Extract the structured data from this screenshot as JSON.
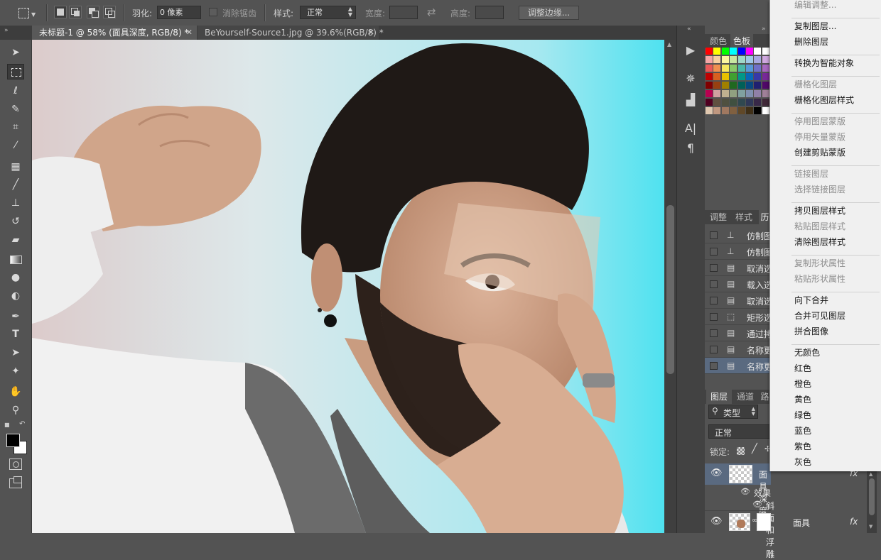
{
  "options_bar": {
    "feather_label": "羽化:",
    "feather_value": "0 像素",
    "antialias_label": "消除锯齿",
    "style_label": "样式:",
    "style_value": "正常",
    "width_label": "宽度:",
    "height_label": "高度:",
    "refine_edge_button": "调整边缘..."
  },
  "document_tabs": [
    {
      "label": "未标题-1 @ 58% (面具深度, RGB/8) *",
      "active": true
    },
    {
      "label": "BeYourself-Source1.jpg @ 39.6%(RGB/8) *",
      "active": false
    }
  ],
  "swatches_panel": {
    "tabs": [
      "颜色",
      "色板"
    ],
    "colors": [
      "#ff0000",
      "#ffff00",
      "#00ff00",
      "#00ffff",
      "#0000ff",
      "#ff00ff",
      "#ffffff",
      "#ffffff",
      "#f4a6a6",
      "#f8d0a0",
      "#fdf6a0",
      "#c8e6a0",
      "#a0d8c8",
      "#a0c8e8",
      "#a8a8e0",
      "#d0a8e0",
      "#e85858",
      "#f09050",
      "#f8e860",
      "#88c868",
      "#48b8a8",
      "#5898d8",
      "#7070c8",
      "#a868c0",
      "#c00000",
      "#d86020",
      "#e8c000",
      "#40a030",
      "#009888",
      "#0868b8",
      "#3838a8",
      "#782898",
      "#800000",
      "#984010",
      "#a08000",
      "#206820",
      "#006058",
      "#084880",
      "#202070",
      "#500868",
      "#b80050",
      "#d0a0a0",
      "#c0b090",
      "#90a080",
      "#80a0a0",
      "#8090b0",
      "#9080a8",
      "#a08098",
      "#500020",
      "#605040",
      "#505040",
      "#405040",
      "#304850",
      "#303858",
      "#382848",
      "#402838",
      "#e0c8b0",
      "#c09880",
      "#a07860",
      "#806040",
      "#604828",
      "#403018",
      "#000000",
      "#ffffff"
    ]
  },
  "adjust_panel": {
    "tabs": [
      "调整",
      "样式",
      "历"
    ]
  },
  "history_items": [
    "仿制图",
    "仿制图",
    "取消选",
    "载入选",
    "取消选",
    "矩形选",
    "通过拷",
    "名称更",
    "名称更"
  ],
  "layers_panel": {
    "tabs": [
      "图层",
      "通道",
      "路"
    ],
    "kind_label": "类型",
    "blend_mode": "正常",
    "lock_label": "锁定:",
    "layers": [
      {
        "name": "面具深度",
        "fx": "fx"
      },
      {
        "name": "效果"
      },
      {
        "name": "斜面和浮雕"
      },
      {
        "name": "面具",
        "fx": "fx"
      }
    ]
  },
  "context_menu": {
    "items": [
      {
        "label": "编辑调整...",
        "disabled": true
      },
      {
        "separator": true
      },
      {
        "label": "复制图层...",
        "disabled": false
      },
      {
        "label": "删除图层",
        "disabled": false
      },
      {
        "separator": true
      },
      {
        "label": "转换为智能对象",
        "disabled": false
      },
      {
        "separator": true
      },
      {
        "label": "栅格化图层",
        "disabled": true
      },
      {
        "label": "栅格化图层样式",
        "disabled": false
      },
      {
        "separator": true
      },
      {
        "label": "停用图层蒙版",
        "disabled": true
      },
      {
        "label": "停用矢量蒙版",
        "disabled": true
      },
      {
        "label": "创建剪贴蒙版",
        "disabled": false
      },
      {
        "separator": true
      },
      {
        "label": "链接图层",
        "disabled": true
      },
      {
        "label": "选择链接图层",
        "disabled": true
      },
      {
        "separator": true
      },
      {
        "label": "拷贝图层样式",
        "disabled": false
      },
      {
        "label": "粘贴图层样式",
        "disabled": true
      },
      {
        "label": "清除图层样式",
        "disabled": false
      },
      {
        "separator": true
      },
      {
        "label": "复制形状属性",
        "disabled": true
      },
      {
        "label": "粘贴形状属性",
        "disabled": true
      },
      {
        "separator": true
      },
      {
        "label": "向下合并",
        "disabled": false
      },
      {
        "label": "合并可见图层",
        "disabled": false
      },
      {
        "label": "拼合图像",
        "disabled": false
      },
      {
        "separator": true
      },
      {
        "label": "无颜色",
        "disabled": false
      },
      {
        "label": "红色",
        "disabled": false
      },
      {
        "label": "橙色",
        "disabled": false
      },
      {
        "label": "黄色",
        "disabled": false
      },
      {
        "label": "绿色",
        "disabled": false
      },
      {
        "label": "蓝色",
        "disabled": false
      },
      {
        "label": "紫色",
        "disabled": false
      },
      {
        "label": "灰色",
        "disabled": false
      }
    ]
  },
  "colors": {
    "menu_bg": "#f0f0f0",
    "panel_bg": "#535353",
    "selected_row": "#5a6a80",
    "canvas_bg_left": "#dccbcb",
    "canvas_bg_right": "#4fe2f0"
  }
}
